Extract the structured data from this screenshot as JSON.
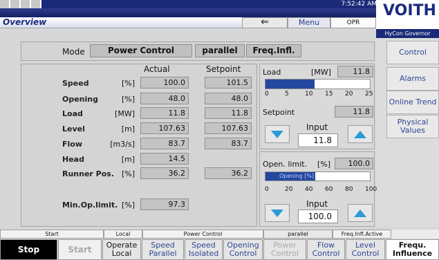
{
  "header": {
    "time": "7:52:42 AM",
    "title": "Overview",
    "back_glyph": "⇐",
    "menu_label": "Menu",
    "operator": "OPR",
    "logo": "VOITH",
    "subtitle": "HyCon Governor"
  },
  "sidebar": {
    "items": [
      {
        "label": "Control"
      },
      {
        "label": "Alarms"
      },
      {
        "label": "Online Trend"
      },
      {
        "label": "Physical Values"
      }
    ]
  },
  "mode": {
    "label": "Mode",
    "control": "Power Control",
    "parallel": "parallel",
    "freq": "Freq.Infl."
  },
  "table": {
    "col_actual": "Actual",
    "col_setpoint": "Setpoint",
    "rows": [
      {
        "label": "Speed",
        "unit": "[%]",
        "actual": "100.0",
        "setpoint": "101.5"
      },
      {
        "label": "Opening",
        "unit": "[%]",
        "actual": "48.0",
        "setpoint": "48.0"
      },
      {
        "label": "Load",
        "unit": "[MW]",
        "actual": "11.8",
        "setpoint": "11.8"
      },
      {
        "label": "Level",
        "unit": "[m]",
        "actual": "107.63",
        "setpoint": "107.63"
      },
      {
        "label": "Flow",
        "unit": "[m3/s]",
        "actual": "83.7",
        "setpoint": "83.7"
      },
      {
        "label": "Head",
        "unit": "[m]",
        "actual": "14.5",
        "setpoint": ""
      },
      {
        "label": "Runner Pos.",
        "unit": "[%]",
        "actual": "36.2",
        "setpoint": "36.2"
      }
    ],
    "min_op": {
      "label": "Min.Op.limit.",
      "unit": "[%]",
      "value": "97.3"
    }
  },
  "load_panel": {
    "label": "Load",
    "unit": "[MW]",
    "value": "11.8",
    "bar_fraction": 0.47,
    "ticks": [
      "0",
      "5",
      "10",
      "15",
      "20",
      "25"
    ],
    "setpoint_label": "Setpoint",
    "setpoint_value": "11.8",
    "input_label": "Input",
    "input_value": "11.8"
  },
  "open_panel": {
    "label": "Open. limit.",
    "unit": "[%]",
    "value": "100.0",
    "opening_label": "Opening [%]",
    "opening_fraction": 0.48,
    "ticks": [
      "0",
      "20",
      "40",
      "60",
      "80",
      "100"
    ],
    "input_label": "Input",
    "input_value": "100.0"
  },
  "status": {
    "cells": [
      "Start",
      "Local",
      "Power Control",
      "parallel",
      "Freq.Infl.Active"
    ]
  },
  "bottom": {
    "stop": "Stop",
    "start": "Start",
    "operate_local": "Operate Local",
    "speed_parallel": "Speed Parallel",
    "speed_isolated": "Speed Isolated",
    "opening_control": "Opening Control",
    "power_control": "Power Control",
    "flow_control": "Flow Control",
    "level_control": "Level Control",
    "frequ_influence": "Frequ. Influence"
  },
  "colors": {
    "navy": "#1a2a78",
    "accent_blue": "#2447a0",
    "arrow_blue": "#2a9bd6"
  }
}
